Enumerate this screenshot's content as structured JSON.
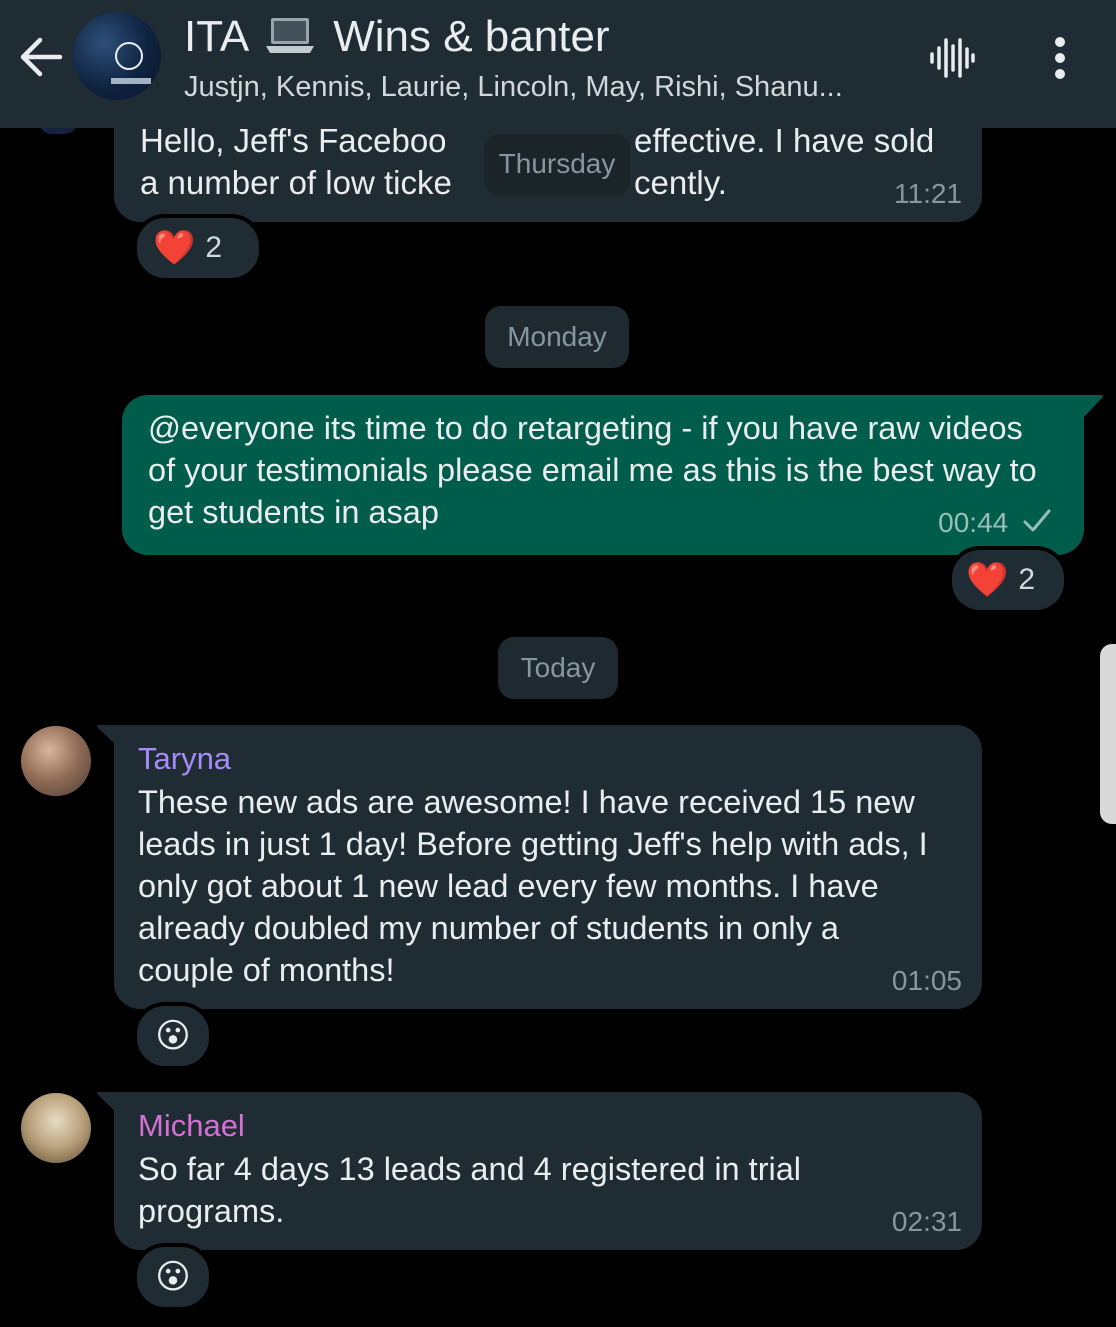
{
  "header": {
    "title_prefix": "ITA",
    "title_suffix": "Wins & banter",
    "members": "Justjn, Kennis, Laurie, Lincoln, May, Rishi, Shanu..."
  },
  "date_chips": {
    "thursday": "Thursday",
    "monday": "Monday",
    "today": "Today"
  },
  "messages": [
    {
      "lines": [
        "Hello,  Jeff's Faceboo",
        "effective.  I have sold",
        "a number of low ticke",
        "cently."
      ],
      "time": "11:21",
      "reaction": {
        "emoji": "❤️",
        "count": "2"
      }
    },
    {
      "text": "@everyone its time to do retargeting - if you have raw videos of your testimonials please email me as this is the best way to get students in asap",
      "time": "00:44",
      "reaction": {
        "emoji": "❤️",
        "count": "2"
      }
    },
    {
      "sender": "Taryna",
      "sender_color": "#a78bfa",
      "text": "These new ads are awesome! I have received 15 new leads in just 1 day! Before getting Jeff's help with ads, I only got about 1 new lead every few months. I have already doubled my number of students in only a couple of months!",
      "time": "01:05",
      "reaction": {
        "emoji": "😮"
      }
    },
    {
      "sender": "Michael",
      "sender_color": "#d46fd6",
      "text": "So far 4 days 13 leads and 4 registered in trial programs.",
      "time": "02:31",
      "reaction": {
        "emoji": "😮"
      }
    }
  ],
  "colors": {
    "header_bg": "#1f2c34",
    "incoming_bubble": "#202c33",
    "outgoing_bubble": "#005c4b",
    "background": "#000000"
  },
  "icons": [
    "back-arrow-icon",
    "voice-wave-icon",
    "more-vert-icon",
    "laptop-icon",
    "read-check-icon"
  ]
}
